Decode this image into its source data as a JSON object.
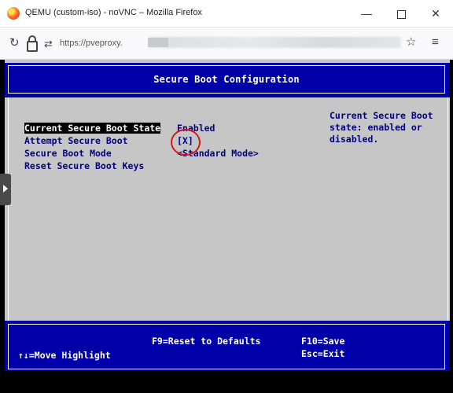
{
  "browser": {
    "window_title": "QEMU (custom-iso) - noVNC – Mozilla Firefox",
    "url_prefix": "https://pveproxy.",
    "icons": {
      "app": "firefox-icon",
      "reload": "reload-icon",
      "lock": "lock-icon",
      "permissions": "permissions-icon",
      "bookmark": "star-icon",
      "menu": "hamburger-menu-icon",
      "minimize": "minimize-icon",
      "maximize": "maximize-icon",
      "close": "close-icon"
    },
    "glyphs": {
      "minimize": "—",
      "close": "✕",
      "reload": "↻",
      "star": "☆",
      "menu": "≡",
      "permissions": "⇄"
    }
  },
  "bios": {
    "title": "Secure Boot Configuration",
    "items": [
      {
        "label": "Current Secure Boot State",
        "value": "Enabled",
        "highlighted": true
      },
      {
        "label": "Attempt Secure Boot",
        "value": "[X]",
        "highlighted": false
      },
      {
        "label": "Secure Boot Mode",
        "value": "<Standard Mode>",
        "highlighted": false
      },
      {
        "label": "Reset Secure Boot Keys",
        "value": "",
        "highlighted": false
      }
    ],
    "help_lines": [
      "Current Secure Boot",
      "state: enabled or",
      "disabled."
    ],
    "footer": {
      "move": "↑↓=Move Highlight",
      "reset": "F9=Reset to Defaults",
      "save": "F10=Save",
      "exit": "Esc=Exit"
    },
    "colors": {
      "header_bg": "#0000a8",
      "body_bg": "#c6c6c6",
      "text": "#000080",
      "annotation": "#d01a1a"
    }
  }
}
